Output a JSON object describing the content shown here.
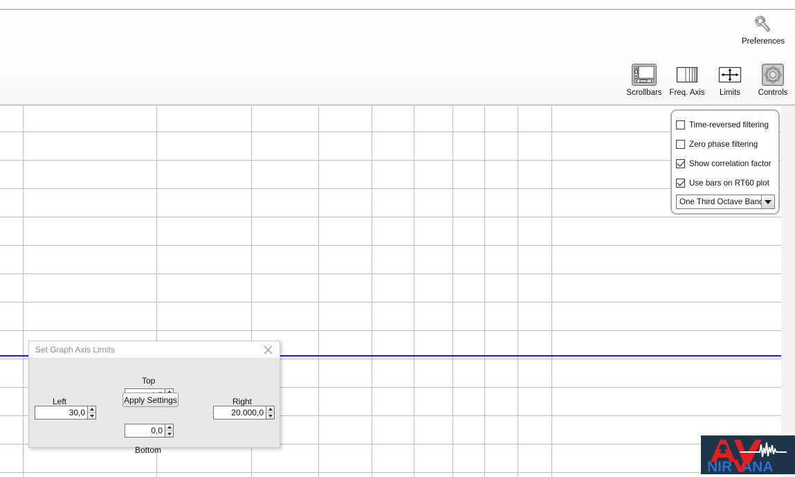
{
  "toolbar": {
    "preferences": {
      "label": "Preferences",
      "icon": "wrench-icon"
    },
    "items": [
      {
        "label": "Scrollbars",
        "icon": "scrollbars-icon"
      },
      {
        "label": "Freq. Axis",
        "icon": "frequency-axis-icon"
      },
      {
        "label": "Limits",
        "icon": "limits-arrows-icon"
      },
      {
        "label": "Controls",
        "icon": "gear-icon"
      }
    ]
  },
  "controls_popup": {
    "checkboxes": [
      {
        "label": "Time-reversed filtering",
        "checked": false
      },
      {
        "label": "Zero phase filtering",
        "checked": false
      },
      {
        "label": "Show correlation factor",
        "checked": true
      },
      {
        "label": "Use bars on RT60 plot",
        "checked": true
      }
    ],
    "band_select": {
      "value": "One Third Octave Bands",
      "icon": "chevron-down-icon"
    }
  },
  "axis_dialog": {
    "title": "Set Graph Axis Limits",
    "close_icon": "close-icon",
    "labels": {
      "top": "Top",
      "left": "Left",
      "right": "Right",
      "bottom": "Bottom"
    },
    "fields": {
      "top": "1,5",
      "left": "30,0",
      "right": "20.000,0",
      "bottom": "0,0"
    },
    "apply_label": "Apply Settings"
  },
  "logo": {
    "text_top": "AV",
    "text_bottom": "NIRVANA",
    "accent": "#e02020",
    "blue": "#2f6fd0",
    "bg": "#1e3449"
  },
  "plot": {
    "trace_color": "#1a1ad0",
    "grid_color": "#b9b9b9",
    "background": "#ffffff"
  }
}
